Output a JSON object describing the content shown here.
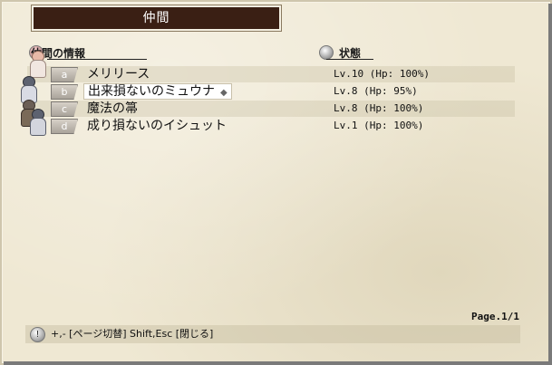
{
  "window": {
    "title": "仲間"
  },
  "headers": {
    "info": "仲間の情報",
    "status": "状態"
  },
  "party": [
    {
      "key": "a",
      "name": "メリリース",
      "status": "Lv.10 (Hp: 100%)",
      "selected": false
    },
    {
      "key": "b",
      "name": "出来損ないのミュウナ",
      "status": "Lv.8 (Hp: 95%)",
      "selected": true
    },
    {
      "key": "c",
      "name": "魔法の箒",
      "status": "Lv.8 (Hp: 100%)",
      "selected": false
    },
    {
      "key": "d",
      "name": "成り損ないのイシュット",
      "status": "Lv.1 (Hp: 100%)",
      "selected": false
    }
  ],
  "footer": {
    "page": "Page.1/1",
    "help": "+,- [ページ切替]  Shift,Esc [閉じる]"
  },
  "colors": {
    "title_bg": "#3a1f14",
    "parchment": "#efe8d3"
  }
}
